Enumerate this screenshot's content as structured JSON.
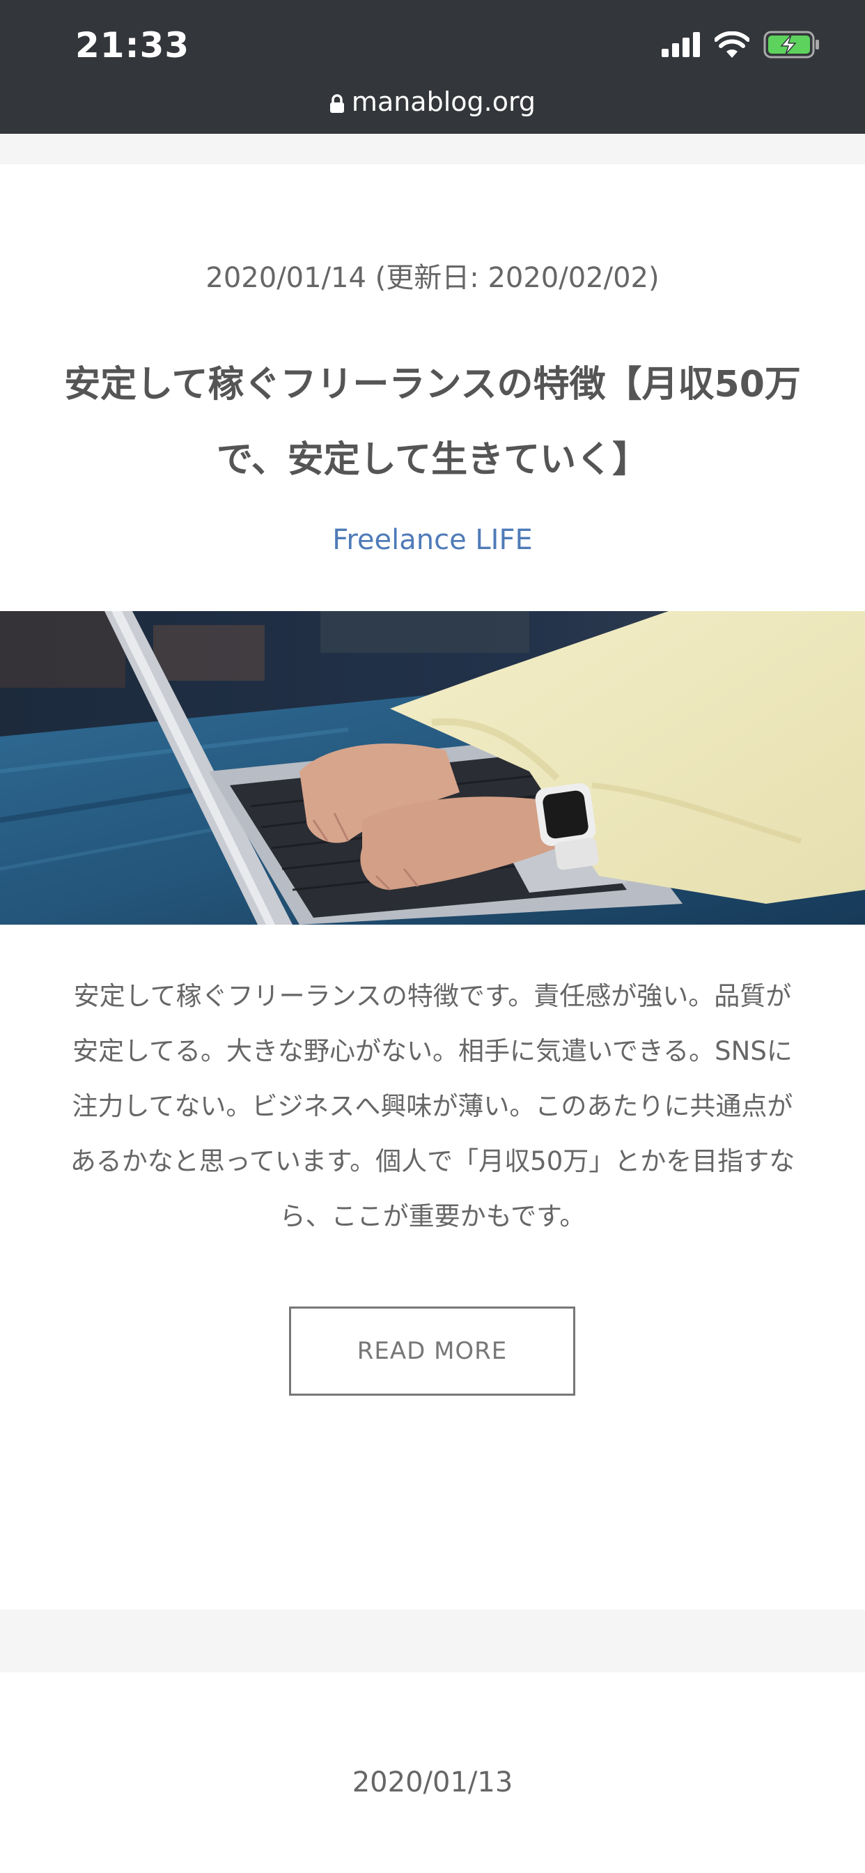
{
  "status_bar": {
    "time": "21:33"
  },
  "browser": {
    "url": "manablog.org"
  },
  "posts": [
    {
      "date": "2020/01/14 (更新日: 2020/02/02)",
      "title_line1": "安定して稼ぐフリーランスの特徴【月収50万",
      "title_line2": "で、安定して生きていく】",
      "category": "Freelance LIFE",
      "excerpt_lines": [
        "安定して稼ぐフリーランスの特徴です。責任感が強い。品質が",
        "安定してる。大きな野心がない。相手に気遣いできる。SNSに",
        "注力してない。ビジネスへ興味が薄い。このあたりに共通点が",
        "あるかなと思っています。個人で「月収50万」とかを目指すな",
        "ら、ここが重要かもです。"
      ],
      "read_more_label": "READ MORE"
    },
    {
      "date": "2020/01/13"
    }
  ],
  "colors": {
    "status_bar_bg": "#33363a",
    "category_link": "#4f7bb8",
    "battery_fill": "#5dd35d"
  },
  "icons": {
    "signal": "cellular-signal-icon",
    "wifi": "wifi-icon",
    "battery": "battery-charging-icon",
    "lock": "lock-icon"
  }
}
